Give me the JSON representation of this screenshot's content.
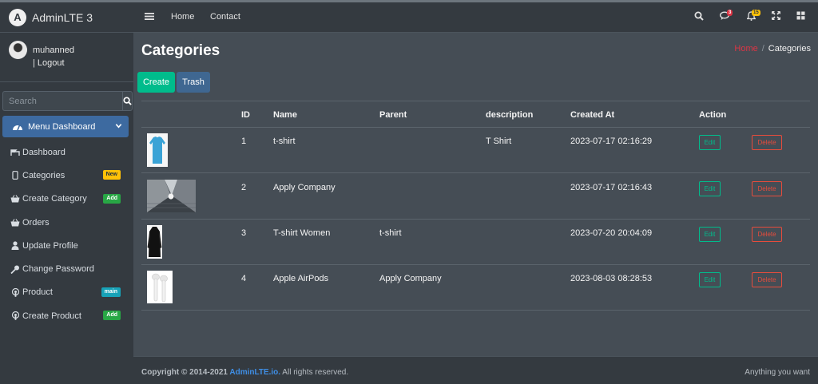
{
  "brand": {
    "name": "AdminLTE 3",
    "logo_letter": "A"
  },
  "user": {
    "name": "muhanned",
    "logout": "| Logout"
  },
  "search": {
    "placeholder": "Search"
  },
  "sidebar": {
    "active": {
      "label": "Menu Dashboard"
    },
    "items": [
      {
        "label": "Dashboard",
        "icon": "tachometer-icon",
        "badge": ""
      },
      {
        "label": "Categories",
        "icon": "mobile-icon",
        "badge": "New",
        "badge_color": "#ffc107"
      },
      {
        "label": "Create Category",
        "icon": "basket-icon",
        "badge": "Add",
        "badge_color": "#28a745"
      },
      {
        "label": "Orders",
        "icon": "basket-icon",
        "badge": ""
      },
      {
        "label": "Update Profile",
        "icon": "user-icon",
        "badge": ""
      },
      {
        "label": "Change Password",
        "icon": "key-icon",
        "badge": ""
      },
      {
        "label": "Product",
        "icon": "podcast-icon",
        "badge": "main",
        "badge_color": "#17a2b8"
      },
      {
        "label": "Create Product",
        "icon": "podcast-icon",
        "badge": "Add",
        "badge_color": "#28a745"
      }
    ]
  },
  "topbar": {
    "links": [
      "Home",
      "Contact"
    ],
    "messages_badge": "3",
    "notifications_badge": "15"
  },
  "page": {
    "title": "Categories",
    "breadcrumb": {
      "home": "Home",
      "separator": "/",
      "current": "Categories"
    },
    "create_label": "Create",
    "trash_label": "Trash"
  },
  "table": {
    "headers": [
      "ID",
      "Name",
      "Parent",
      "description",
      "Created At",
      "Action"
    ],
    "edit_label": "Edit",
    "delete_label": "Delete",
    "rows": [
      {
        "id": "1",
        "name": "t-shirt",
        "parent": "",
        "description": "T Shirt",
        "created_at": "2023-07-17 02:16:29",
        "image": "blue-shirt"
      },
      {
        "id": "2",
        "name": "Apply Company",
        "parent": "",
        "description": "",
        "created_at": "2023-07-17 02:16:43",
        "image": "apple-building"
      },
      {
        "id": "3",
        "name": "T-shirt Women",
        "parent": "t-shirt",
        "description": "",
        "created_at": "2023-07-20 20:04:09",
        "image": "black-coat"
      },
      {
        "id": "4",
        "name": "Apple AirPods",
        "parent": "Apply Company",
        "description": "",
        "created_at": "2023-08-03 08:28:53",
        "image": "airpods"
      }
    ]
  },
  "footer": {
    "copyright_prefix": "Copyright © 2014-2021 ",
    "copyright_brand": "AdminLTE.io.",
    "copyright_suffix": " All rights reserved.",
    "right_text": "Anything you want"
  }
}
